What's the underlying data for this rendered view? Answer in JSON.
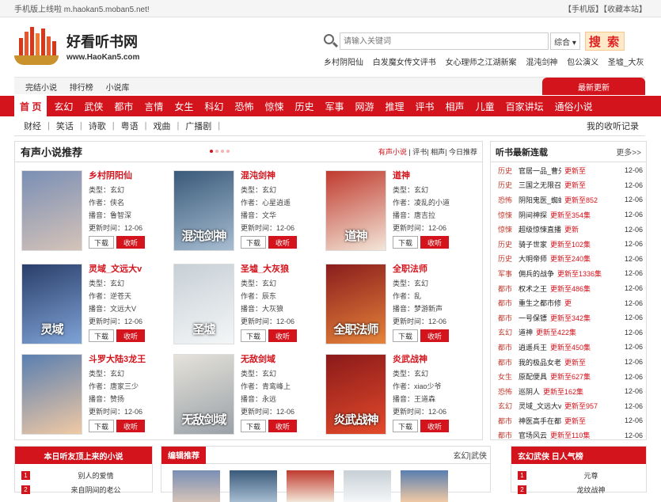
{
  "topbar": {
    "left": "手机版上线啦 m.haokan5.moban5.net!",
    "mobile": "【手机版】",
    "fav": "【收藏本站】"
  },
  "logo": {
    "title": "好看听书网",
    "url": "www.HaoKan5.com"
  },
  "search": {
    "placeholder": "请输入关键词",
    "select": "综合 ▾",
    "button": "搜 索"
  },
  "hot_words": [
    "乡村阴阳仙",
    "白发魔女传文评书",
    "女心理师之江湖新案",
    "混沌剑神",
    "包公演义",
    "圣墟_大灰"
  ],
  "subnav": {
    "items": [
      "完结小说",
      "排行榜",
      "小说库"
    ],
    "newest": "最新更新"
  },
  "main_nav": [
    "首 页",
    "玄幻",
    "武侠",
    "都市",
    "言情",
    "女生",
    "科幻",
    "恐怖",
    "惊悚",
    "历史",
    "军事",
    "网游",
    "推理",
    "评书",
    "相声",
    "儿童",
    "百家讲坛",
    "通俗小说"
  ],
  "categories": [
    "财经",
    "笑话",
    "诗歌",
    "粤语",
    "戏曲",
    "广播剧"
  ],
  "my_records": "我的收听记录",
  "recommend": {
    "title": "有声小说推荐",
    "links": [
      "有声小说",
      "评书",
      "相声",
      "今日推荐"
    ],
    "labels": {
      "type": "类型：",
      "author": "作者：",
      "anchor": "播音：",
      "time": "更新时间：",
      "download": "下载",
      "listen": "收听"
    },
    "books": [
      {
        "name": "乡村阴阳仙",
        "type": "玄幻",
        "author": "侠名",
        "anchor": "鲁智深",
        "time": "12-06",
        "cover_text": "",
        "c1": "#7a8fb5",
        "c2": "#d5c3b8"
      },
      {
        "name": "混沌剑神",
        "type": "玄幻",
        "author": "心星逍遥",
        "anchor": "文华",
        "time": "12-06",
        "cover_text": "混沌剑神",
        "c1": "#3a5a7a",
        "c2": "#a7bdd1"
      },
      {
        "name": "道神",
        "type": "玄幻",
        "author": "凌乱的小道",
        "anchor": "唐吉拉",
        "time": "12-06",
        "cover_text": "道神",
        "c1": "#c03a2e",
        "c2": "#f2e6d8"
      },
      {
        "name": "灵域_文远大v",
        "type": "玄幻",
        "author": "逆苍天",
        "anchor": "文远大V",
        "time": "12-06",
        "cover_text": "灵域",
        "c1": "#2a3e6a",
        "c2": "#7fa3d6"
      },
      {
        "name": "圣墟_大灰狼",
        "type": "玄幻",
        "author": "辰东",
        "anchor": "大灰狼",
        "time": "12-06",
        "cover_text": "圣墟",
        "c1": "#c7d0d6",
        "c2": "#f4f6f7"
      },
      {
        "name": "全职法师",
        "type": "玄幻",
        "author": "乱",
        "anchor": "梦游新声",
        "time": "12-06",
        "cover_text": "全职法师",
        "c1": "#8a1d1d",
        "c2": "#e6843a"
      },
      {
        "name": "斗罗大陆3龙王",
        "type": "玄幻",
        "author": "唐家三少",
        "anchor": "赞扬",
        "time": "12-06",
        "cover_text": "",
        "c1": "#5a7fb0",
        "c2": "#f0c9a4"
      },
      {
        "name": "无敌剑域",
        "type": "玄幻",
        "author": "青鸾峰上",
        "anchor": "永远",
        "time": "12-06",
        "cover_text": "无敌剑域",
        "c1": "#e5e2da",
        "c2": "#9aa1a8"
      },
      {
        "name": "炎武战神",
        "type": "玄幻",
        "author": "xiao少爷",
        "anchor": "王道森",
        "time": "12-06",
        "cover_text": "炎武战神",
        "c1": "#8a1a1a",
        "c2": "#e34a2a"
      }
    ]
  },
  "latest": {
    "title": "听书最新连载",
    "more": "更多>>",
    "items": [
      {
        "genre": "历史",
        "name": "官居一品_曹先森",
        "update": "更新至",
        "date": "12-06"
      },
      {
        "genre": "历史",
        "name": "三国之无限召唤",
        "update": "更新至",
        "date": "12-06"
      },
      {
        "genre": "恐怖",
        "name": "阴阳鬼医_蜘蛛",
        "update": "更新至852",
        "date": "12-06"
      },
      {
        "genre": "惊悚",
        "name": "阴间神探",
        "update": "更新至354集",
        "date": "12-06"
      },
      {
        "genre": "惊悚",
        "name": "超级惊悚直播_紫襟",
        "update": "更新",
        "date": "12-06"
      },
      {
        "genre": "历史",
        "name": "骑子世家",
        "update": "更新至102集",
        "date": "12-06"
      },
      {
        "genre": "历史",
        "name": "大明帝师",
        "update": "更新至240集",
        "date": "12-06"
      },
      {
        "genre": "军事",
        "name": "佣兵的战争",
        "update": "更新至1336集",
        "date": "12-06"
      },
      {
        "genre": "都市",
        "name": "权术之王",
        "update": "更新至486集",
        "date": "12-06"
      },
      {
        "genre": "都市",
        "name": "重生之都市修仙_土金",
        "update": "更",
        "date": "12-06"
      },
      {
        "genre": "都市",
        "name": "一号保镖",
        "update": "更新至342集",
        "date": "12-06"
      },
      {
        "genre": "玄幻",
        "name": "道神",
        "update": "更新至422集",
        "date": "12-06"
      },
      {
        "genre": "都市",
        "name": "逍遥兵王",
        "update": "更新至450集",
        "date": "12-06"
      },
      {
        "genre": "都市",
        "name": "我的极品女老师",
        "update": "更新至",
        "date": "12-06"
      },
      {
        "genre": "女生",
        "name": "原配便具",
        "update": "更新至627集",
        "date": "12-06"
      },
      {
        "genre": "恐怖",
        "name": "巡阴人",
        "update": "更新至162集",
        "date": "12-06"
      },
      {
        "genre": "玄幻",
        "name": "灵域_文远大v",
        "update": "更新至957",
        "date": "12-06"
      },
      {
        "genre": "都市",
        "name": "神医高手在都市",
        "update": "更新至",
        "date": "12-06"
      },
      {
        "genre": "都市",
        "name": "官场风云",
        "update": "更新至110集",
        "date": "12-06"
      }
    ]
  },
  "bottom": {
    "panel1": {
      "title": "本日听友顶上来的小说",
      "items": [
        "别人的爱情",
        "来自阴间的老公"
      ]
    },
    "panel2": {
      "title": "编辑推荐",
      "tag": "玄幻|武侠"
    },
    "panel3": {
      "title": "玄幻武侠 日人气榜",
      "items": [
        "元尊",
        "龙纹战神"
      ]
    }
  },
  "colors": {
    "accent": "#d3141d"
  }
}
